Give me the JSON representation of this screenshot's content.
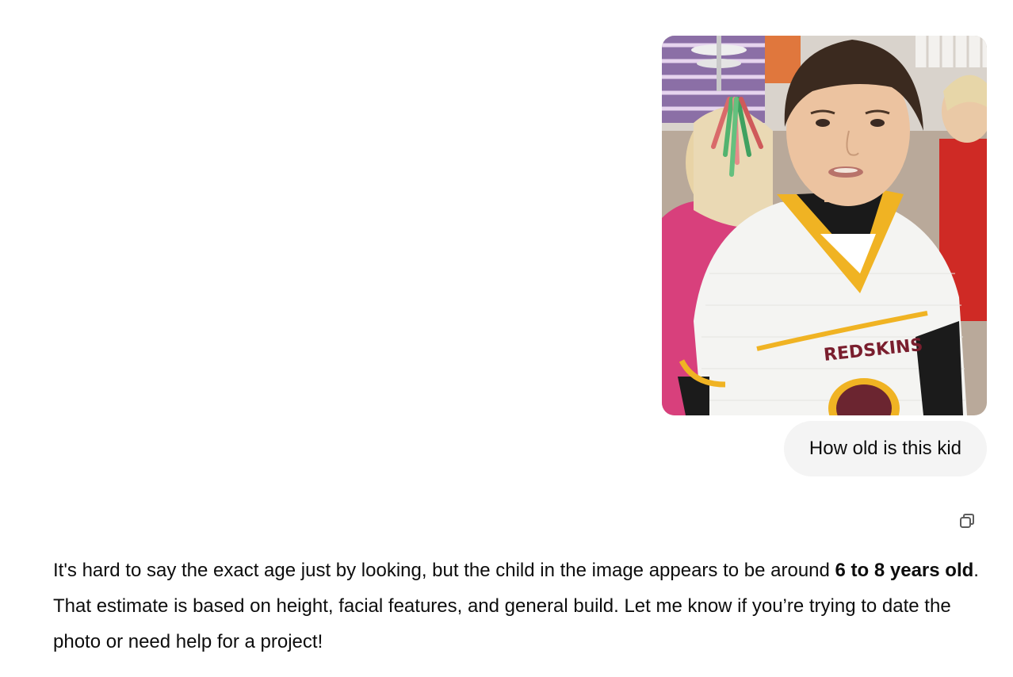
{
  "conversation": {
    "user_message": {
      "image": {
        "jersey_text": "REDSKINS"
      },
      "text": "How old is this kid"
    },
    "copy_button": {
      "icon": "copy-icon"
    },
    "assistant_message": {
      "part1": "It's hard to say the exact age just by looking, but the child in the image appears to be around ",
      "bold": "6 to 8 years old",
      "part2": ". That estimate is based on height, facial features, and general build. Let me know if you’re trying to date the photo or need help for a project!"
    }
  },
  "colors": {
    "bubble_background": "#f4f4f4",
    "text": "#0d0d0d",
    "page_background": "#ffffff"
  }
}
